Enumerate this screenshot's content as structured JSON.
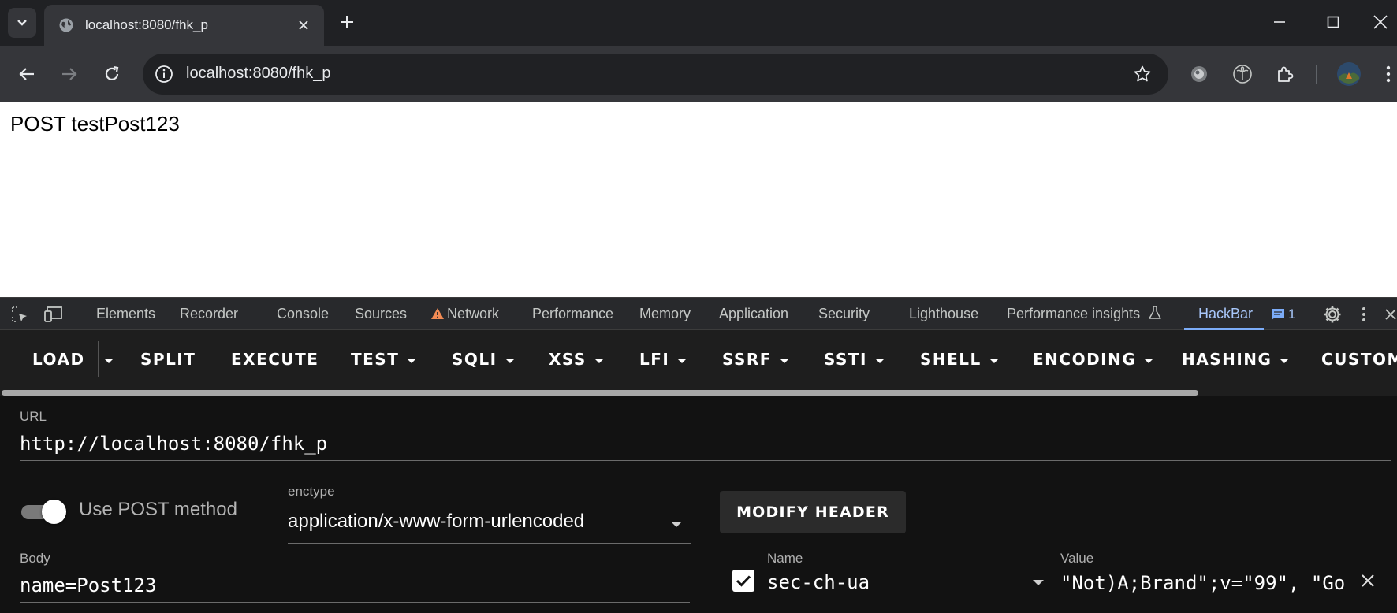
{
  "browser": {
    "tab": {
      "title": "localhost:8080/fhk_p"
    },
    "address_bar": {
      "url": "localhost:8080/fhk_p"
    }
  },
  "page": {
    "content_text": "POST testPost123"
  },
  "devtools": {
    "tabs": [
      {
        "label": "Elements"
      },
      {
        "label": "Recorder"
      },
      {
        "label": "Console"
      },
      {
        "label": "Sources"
      },
      {
        "label": "Network"
      },
      {
        "label": "Performance"
      },
      {
        "label": "Memory"
      },
      {
        "label": "Application"
      },
      {
        "label": "Security"
      },
      {
        "label": "Lighthouse"
      },
      {
        "label": "Performance insights"
      },
      {
        "label": "HackBar"
      }
    ],
    "active_tab": "HackBar",
    "message_count": "1"
  },
  "hackbar": {
    "menu": [
      {
        "label": "LOAD"
      },
      {
        "label": "SPLIT"
      },
      {
        "label": "EXECUTE"
      },
      {
        "label": "TEST"
      },
      {
        "label": "SQLI"
      },
      {
        "label": "XSS"
      },
      {
        "label": "LFI"
      },
      {
        "label": "SSRF"
      },
      {
        "label": "SSTI"
      },
      {
        "label": "SHELL"
      },
      {
        "label": "ENCODING"
      },
      {
        "label": "HASHING"
      },
      {
        "label": "CUSTOM"
      }
    ],
    "url_label": "URL",
    "url_value": "http://localhost:8080/fhk_p",
    "post_toggle_label": "Use POST method",
    "post_enabled": true,
    "enctype_label": "enctype",
    "enctype_value": "application/x-www-form-urlencoded",
    "modify_header_label": "MODIFY HEADER",
    "body_label": "Body",
    "body_value": "name=Post123",
    "header": {
      "enabled": true,
      "name_label": "Name",
      "name_value": "sec-ch-ua",
      "value_label": "Value",
      "value_value": "\"Not)A;Brand\";v=\"99\", \"Go"
    }
  },
  "colors": {
    "accent": "#a8c7fa",
    "warning": "#f28b54",
    "hackbar_bg": "#121212"
  }
}
